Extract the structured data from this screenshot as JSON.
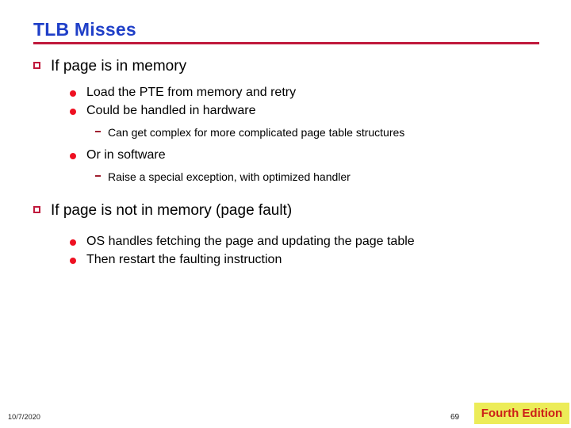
{
  "slide": {
    "title": "TLB Misses",
    "title_color": "#1F3FC8",
    "rule_color": "#C0193C"
  },
  "bullets": {
    "square_glyph": "❑",
    "disc_glyph": "●",
    "dash_glyph": "-",
    "square_color": "#C0193C",
    "disc_color": "#EE1122",
    "dash_color": "#A02030"
  },
  "content": [
    {
      "level": 1,
      "text": "If page is in memory"
    },
    {
      "level": 2,
      "text": "Load the PTE from memory and retry"
    },
    {
      "level": 2,
      "text": "Could be handled in hardware"
    },
    {
      "level": 3,
      "text": "Can get complex for more complicated page table structures"
    },
    {
      "level": 2,
      "text": "Or in software"
    },
    {
      "level": 3,
      "text": "Raise a special exception, with optimized handler"
    },
    {
      "level": 1,
      "text": "If page is not in memory (page fault)"
    },
    {
      "level": 2,
      "text": "OS handles fetching the page and updating the page table"
    },
    {
      "level": 2,
      "text": "Then restart the faulting instruction"
    }
  ],
  "footer": {
    "date": "10/7/2020",
    "page_number": "69",
    "edition_label": "Fourth Edition",
    "edition_bg": "#ECEC58",
    "edition_color": "#CC2018"
  }
}
